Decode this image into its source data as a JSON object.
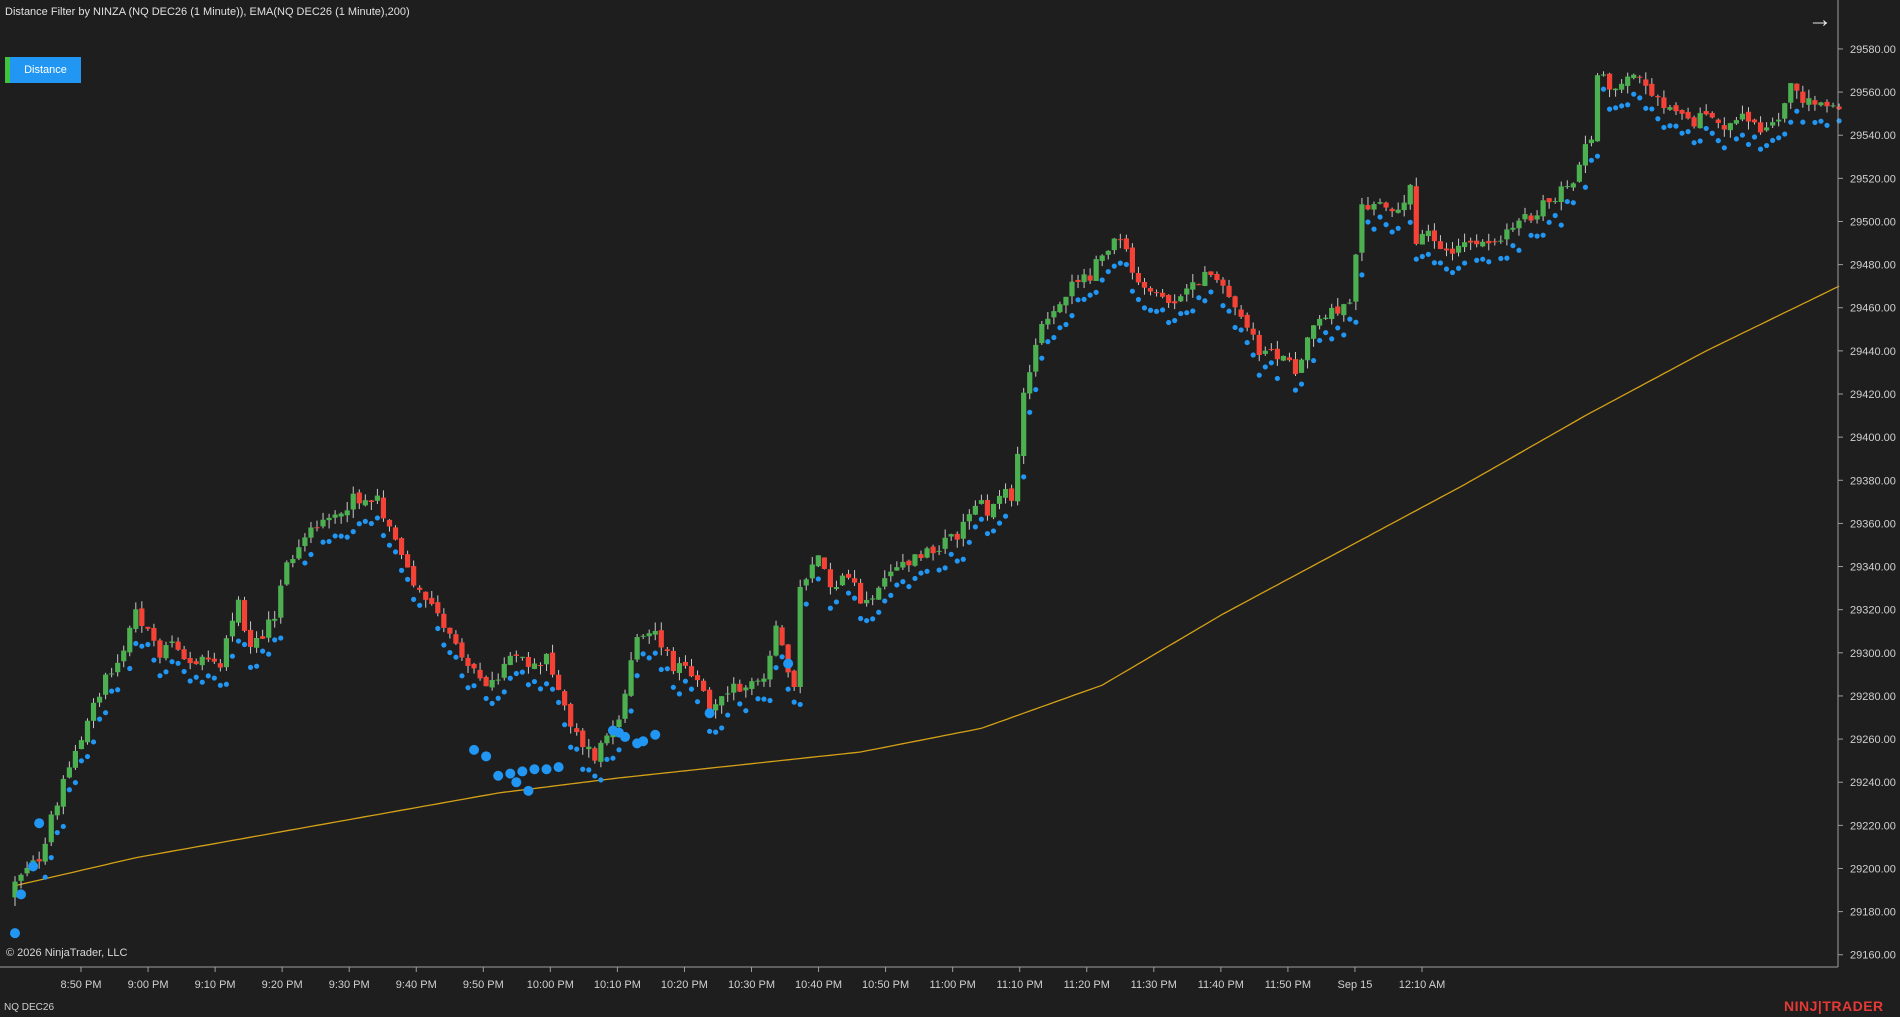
{
  "header": {
    "title": "Distance Filter by NINZA (NQ DEC26 (1 Minute)), EMA(NQ DEC26 (1 Minute),200)"
  },
  "toolbar": {
    "distance_button_label": "Distance",
    "arrow_icon": "arrow-right-icon"
  },
  "footer": {
    "copyright": "© 2026 NinjaTrader, LLC",
    "instrument": "NQ DEC26",
    "brand_left": "NINJ",
    "brand_right": "TRADER"
  },
  "colors": {
    "background": "#1e1e1e",
    "up_candle": "#4caf50",
    "down_candle": "#f44336",
    "wick": "#c8c8c8",
    "dot": "#2196f3",
    "ema": "#d4a017",
    "grid_axis": "#9e9e9e",
    "distance_button": "#2196f3"
  },
  "chart_data": {
    "type": "candlestick",
    "title": "Distance Filter by NINZA (NQ DEC26 (1 Minute)), EMA(NQ DEC26 (1 Minute),200)",
    "x_ticks": [
      "8:50 PM",
      "9:00 PM",
      "9:10 PM",
      "9:20 PM",
      "9:30 PM",
      "9:40 PM",
      "9:50 PM",
      "10:00 PM",
      "10:10 PM",
      "10:20 PM",
      "10:30 PM",
      "10:40 PM",
      "10:50 PM",
      "11:00 PM",
      "11:10 PM",
      "11:20 PM",
      "11:30 PM",
      "11:40 PM",
      "11:50 PM",
      "Sep 15",
      "12:10 AM"
    ],
    "y_ticks": [
      "29160.00",
      "29180.00",
      "29200.00",
      "29220.00",
      "29240.00",
      "29260.00",
      "29280.00",
      "29300.00",
      "29320.00",
      "29340.00",
      "29360.00",
      "29380.00",
      "29400.00",
      "29420.00",
      "29440.00",
      "29460.00",
      "29480.00",
      "29500.00",
      "29520.00",
      "29540.00",
      "29560.00",
      "29580.00"
    ],
    "ylim": [
      29152,
      29586
    ],
    "close_path": [
      [
        0,
        29193
      ],
      [
        4,
        29205
      ],
      [
        8,
        29240
      ],
      [
        11,
        29260
      ],
      [
        15,
        29290
      ],
      [
        18,
        29300
      ],
      [
        20,
        29318
      ],
      [
        24,
        29300
      ],
      [
        26,
        29305
      ],
      [
        30,
        29295
      ],
      [
        34,
        29296
      ],
      [
        37,
        29326
      ],
      [
        39,
        29300
      ],
      [
        43,
        29318
      ],
      [
        45,
        29340
      ],
      [
        48,
        29355
      ],
      [
        52,
        29360
      ],
      [
        56,
        29372
      ],
      [
        60,
        29370
      ],
      [
        63,
        29355
      ],
      [
        66,
        29330
      ],
      [
        70,
        29320
      ],
      [
        73,
        29302
      ],
      [
        76,
        29290
      ],
      [
        79,
        29285
      ],
      [
        82,
        29298
      ],
      [
        86,
        29293
      ],
      [
        88,
        29300
      ],
      [
        90,
        29282
      ],
      [
        92,
        29265
      ],
      [
        94,
        29258
      ],
      [
        96,
        29252
      ],
      [
        98,
        29262
      ],
      [
        100,
        29272
      ],
      [
        103,
        29305
      ],
      [
        106,
        29310
      ],
      [
        109,
        29294
      ],
      [
        112,
        29290
      ],
      [
        115,
        29275
      ],
      [
        117,
        29280
      ],
      [
        120,
        29285
      ],
      [
        124,
        29290
      ],
      [
        126,
        29310
      ],
      [
        129,
        29283
      ],
      [
        130,
        29330
      ],
      [
        133,
        29345
      ],
      [
        135,
        29330
      ],
      [
        138,
        29336
      ],
      [
        140,
        29325
      ],
      [
        143,
        29328
      ],
      [
        146,
        29340
      ],
      [
        149,
        29345
      ],
      [
        153,
        29350
      ],
      [
        156,
        29355
      ],
      [
        159,
        29370
      ],
      [
        161,
        29366
      ],
      [
        164,
        29375
      ],
      [
        165,
        29368
      ],
      [
        167,
        29420
      ],
      [
        170,
        29455
      ],
      [
        173,
        29460
      ],
      [
        175,
        29470
      ],
      [
        178,
        29475
      ],
      [
        180,
        29485
      ],
      [
        183,
        29493
      ],
      [
        185,
        29476
      ],
      [
        188,
        29470
      ],
      [
        191,
        29460
      ],
      [
        194,
        29470
      ],
      [
        197,
        29475
      ],
      [
        200,
        29470
      ],
      [
        203,
        29455
      ],
      [
        206,
        29440
      ],
      [
        209,
        29438
      ],
      [
        212,
        29432
      ],
      [
        215,
        29452
      ],
      [
        218,
        29460
      ],
      [
        221,
        29460
      ],
      [
        223,
        29505
      ],
      [
        226,
        29510
      ],
      [
        228,
        29502
      ],
      [
        231,
        29515
      ],
      [
        232,
        29490
      ],
      [
        234,
        29494
      ],
      [
        237,
        29485
      ],
      [
        240,
        29488
      ],
      [
        243,
        29492
      ],
      [
        246,
        29490
      ],
      [
        249,
        29500
      ],
      [
        252,
        29505
      ],
      [
        255,
        29512
      ],
      [
        258,
        29520
      ],
      [
        261,
        29540
      ],
      [
        262,
        29570
      ],
      [
        265,
        29560
      ],
      [
        268,
        29570
      ],
      [
        271,
        29557
      ],
      [
        274,
        29552
      ],
      [
        277,
        29545
      ],
      [
        280,
        29550
      ],
      [
        283,
        29545
      ],
      [
        286,
        29548
      ],
      [
        289,
        29542
      ],
      [
        292,
        29550
      ],
      [
        294,
        29562
      ],
      [
        297,
        29555
      ],
      [
        300,
        29555
      ],
      [
        302,
        29552
      ]
    ],
    "ema": [
      [
        0,
        29192
      ],
      [
        20,
        29205
      ],
      [
        40,
        29215
      ],
      [
        60,
        29225
      ],
      [
        80,
        29235
      ],
      [
        100,
        29242
      ],
      [
        120,
        29248
      ],
      [
        140,
        29254
      ],
      [
        160,
        29265
      ],
      [
        180,
        29285
      ],
      [
        200,
        29318
      ],
      [
        220,
        29348
      ],
      [
        240,
        29378
      ],
      [
        260,
        29410
      ],
      [
        280,
        29440
      ],
      [
        302,
        29470
      ]
    ],
    "big_dots": [
      [
        0,
        29170
      ],
      [
        1,
        29188
      ],
      [
        3,
        29201
      ],
      [
        4,
        29221
      ],
      [
        76,
        29255
      ],
      [
        78,
        29252
      ],
      [
        80,
        29243
      ],
      [
        82,
        29244
      ],
      [
        83,
        29240
      ],
      [
        84,
        29245
      ],
      [
        85,
        29236
      ],
      [
        86,
        29246
      ],
      [
        88,
        29246
      ],
      [
        90,
        29247
      ],
      [
        99,
        29264
      ],
      [
        100,
        29263
      ],
      [
        101,
        29261
      ],
      [
        103,
        29258
      ],
      [
        104,
        29259
      ],
      [
        106,
        29262
      ],
      [
        115,
        29272
      ],
      [
        128,
        29295
      ]
    ],
    "legend_button": "Distance",
    "grid": false
  }
}
